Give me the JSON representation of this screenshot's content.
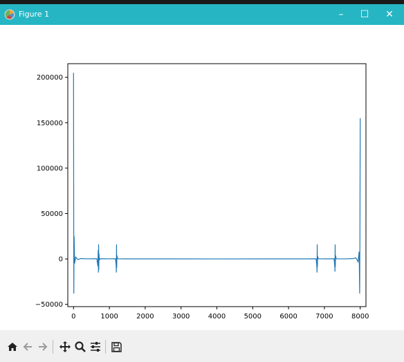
{
  "window": {
    "title": "Figure 1",
    "buttons": {
      "minimize": "–",
      "maximize": "☐",
      "close": "✕"
    }
  },
  "icons": [
    "figure-app-icon",
    "home-icon",
    "back-arrow-icon",
    "forward-arrow-icon",
    "pan-icon",
    "zoom-icon",
    "configure-subplots-icon",
    "save-icon"
  ],
  "colors": {
    "titlebar": "#26b5c3",
    "line": "#1f77b4",
    "toolbar": "#f0f0f0"
  },
  "chart_data": {
    "type": "line",
    "title": "",
    "xlabel": "",
    "ylabel": "",
    "xlim": [
      -160,
      8160
    ],
    "ylim": [
      -52500,
      215000
    ],
    "xticks": [
      0,
      1000,
      2000,
      3000,
      4000,
      5000,
      6000,
      7000,
      8000
    ],
    "yticks": [
      -50000,
      0,
      50000,
      100000,
      150000,
      200000
    ],
    "grid": false,
    "legend": "none",
    "series": [
      {
        "color": "#1f77b4",
        "x": [
          0,
          8,
          16,
          30,
          60,
          120,
          200,
          400,
          650,
          680,
          690,
          695,
          700,
          705,
          710,
          720,
          750,
          1000,
          1170,
          1190,
          1195,
          1200,
          1205,
          1210,
          1230,
          1500,
          4000,
          6500,
          6770,
          6790,
          6795,
          6800,
          6805,
          6810,
          6830,
          7100,
          7270,
          7290,
          7295,
          7300,
          7305,
          7310,
          7330,
          7600,
          7800,
          7880,
          7940,
          7970,
          7985,
          7992,
          8000
        ],
        "y": [
          205000,
          -38000,
          25000,
          -5000,
          2000,
          -600,
          400,
          150,
          300,
          -8000,
          10000,
          -15000,
          16000,
          -12000,
          6000,
          -1000,
          300,
          150,
          300,
          -7000,
          -15000,
          16000,
          -10000,
          4000,
          200,
          100,
          50,
          100,
          200,
          -8000,
          -15000,
          16000,
          -9000,
          3000,
          200,
          100,
          300,
          -8000,
          -14000,
          16000,
          -9000,
          4000,
          200,
          150,
          400,
          1200,
          -3000,
          8000,
          -38000,
          25000,
          155000
        ]
      }
    ]
  }
}
